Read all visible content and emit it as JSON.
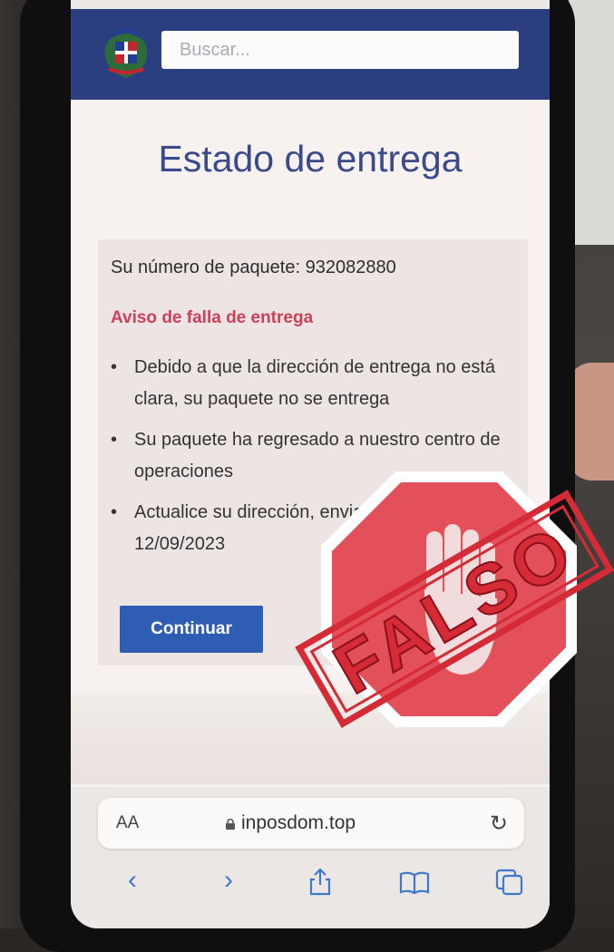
{
  "header": {
    "search_placeholder": "Buscar..."
  },
  "page": {
    "title": "Estado de entrega"
  },
  "card": {
    "package_line": "Su número de paquete: 932082880",
    "warning": "Aviso de falla de entrega",
    "items": [
      "Debido a que la dirección de entrega no está clara, su paquete no se entrega",
      "Su paquete ha regresado a nuestro centro de operaciones",
      "Actualice su dirección, envian nuevamente en 12/09/2023"
    ],
    "continue_label": "Continuar"
  },
  "browser": {
    "aa_label": "AA",
    "url": "inposdom.top"
  },
  "stamp": {
    "text": "FALSO"
  },
  "colors": {
    "header": "#2b3f80",
    "title": "#3a4a8a",
    "warning": "#cf3f5a",
    "button": "#2f5db3",
    "stamp": "#d42b36"
  },
  "icons": [
    "coat-of-arms-icon",
    "lock-icon",
    "reload-icon",
    "back-icon",
    "forward-icon",
    "share-icon",
    "bookmarks-icon",
    "tabs-icon",
    "stop-hand-icon"
  ]
}
